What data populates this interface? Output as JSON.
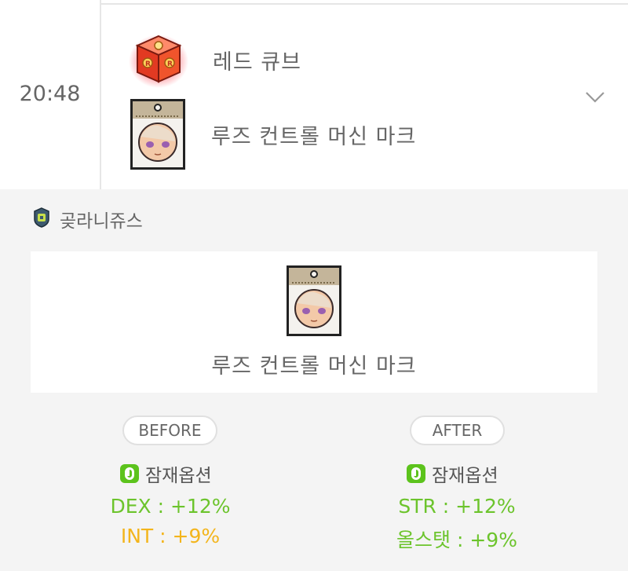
{
  "log": {
    "time": "20:48",
    "items": [
      {
        "label": "레드 큐브",
        "icon": "red-cube-icon"
      },
      {
        "label": "루즈 컨트롤 머신 마크",
        "icon": "machine-mark-icon"
      }
    ],
    "expand_icon": "chevron-down-icon"
  },
  "detail": {
    "character_name": "곶라니쥬스",
    "world_icon": "world-emblem-icon",
    "item_name": "루즈 컨트롤 머신 마크",
    "before": {
      "label": "BEFORE",
      "section": "잠재옵션",
      "options": [
        {
          "text": "DEX : +12%",
          "color": "#6cc42c"
        },
        {
          "text": "INT : +9%",
          "color": "#f3b51c"
        }
      ]
    },
    "after": {
      "label": "AFTER",
      "section": "잠재옵션",
      "options": [
        {
          "text": "STR : +12%",
          "color": "#6cc42c"
        },
        {
          "text": "올스탯 : +9%",
          "color": "#6cc42c"
        }
      ]
    }
  },
  "colors": {
    "legendary": "#6cc42c",
    "unique": "#f3b51c",
    "badge": "#5cc31c"
  }
}
